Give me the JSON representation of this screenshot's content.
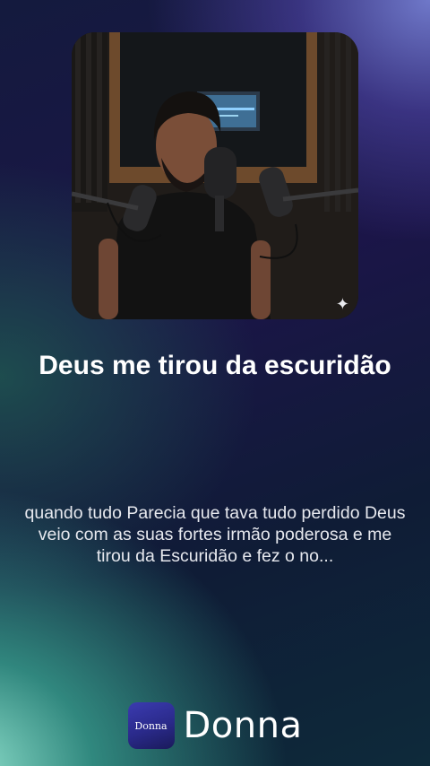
{
  "cover": {
    "alt": "cover-image",
    "sparkle_icon": "sparkle-icon"
  },
  "post": {
    "title": "Deus me tirou da escuridão",
    "description": "quando tudo Parecia que tava tudo perdido Deus veio com as suas fortes irmão poderosa e me tirou da Escuridão e fez o no..."
  },
  "brand": {
    "logo_text": "Donna",
    "name": "Donna"
  }
}
